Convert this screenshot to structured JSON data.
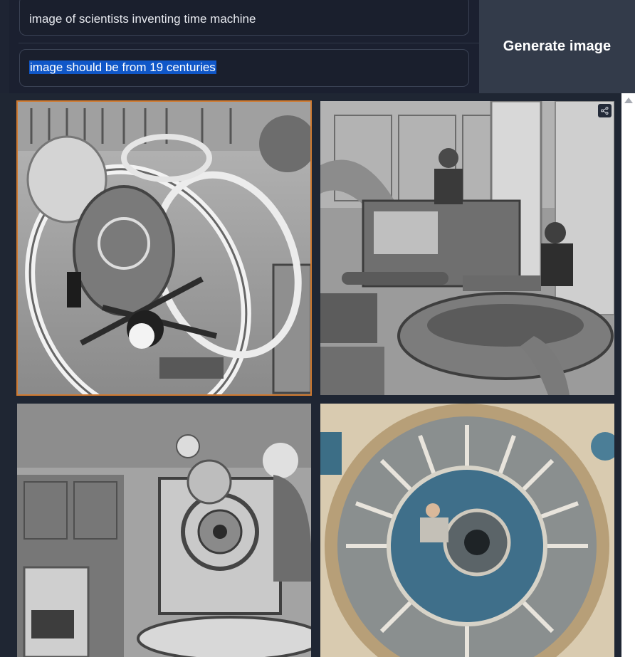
{
  "prompts": {
    "first": "image of scientists inventing time machine",
    "second": "image should be from 19 centuries"
  },
  "actions": {
    "generate_label": "Generate image"
  },
  "gallery": {
    "images": [
      {
        "name": "generated-image-1",
        "selected": true
      },
      {
        "name": "generated-image-2",
        "selected": false,
        "icon": "share-icon"
      },
      {
        "name": "generated-image-3",
        "selected": false
      },
      {
        "name": "generated-image-4",
        "selected": false
      }
    ]
  },
  "colors": {
    "selection": "#1057c8",
    "selected_border": "#d07a30",
    "button_bg": "#333b4a"
  }
}
